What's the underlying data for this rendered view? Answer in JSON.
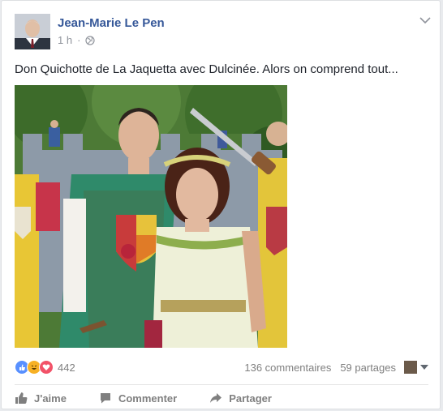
{
  "post": {
    "author": "Jean-Marie Le Pen",
    "time": "1 h",
    "visibility_icon": "globe-icon",
    "text": "Don Quichotte de La Jaquetta avec Dulcinée. Alors on comprend tout...",
    "photo_description": "Man in green costume with coat of arms next to a woman in a white dress with a flower crown, sword held behind them",
    "reactions": [
      "like",
      "haha",
      "love"
    ],
    "reaction_count": "442",
    "comments": "136 commentaires",
    "shares": "59 partages"
  },
  "actions": {
    "like": "J'aime",
    "comment": "Commenter",
    "share": "Partager"
  },
  "colors": {
    "author": "#365899",
    "text": "#1d2129",
    "muted": "#90949c",
    "like": "#5890ff",
    "haha": "#f7b125",
    "love": "#f25268"
  }
}
